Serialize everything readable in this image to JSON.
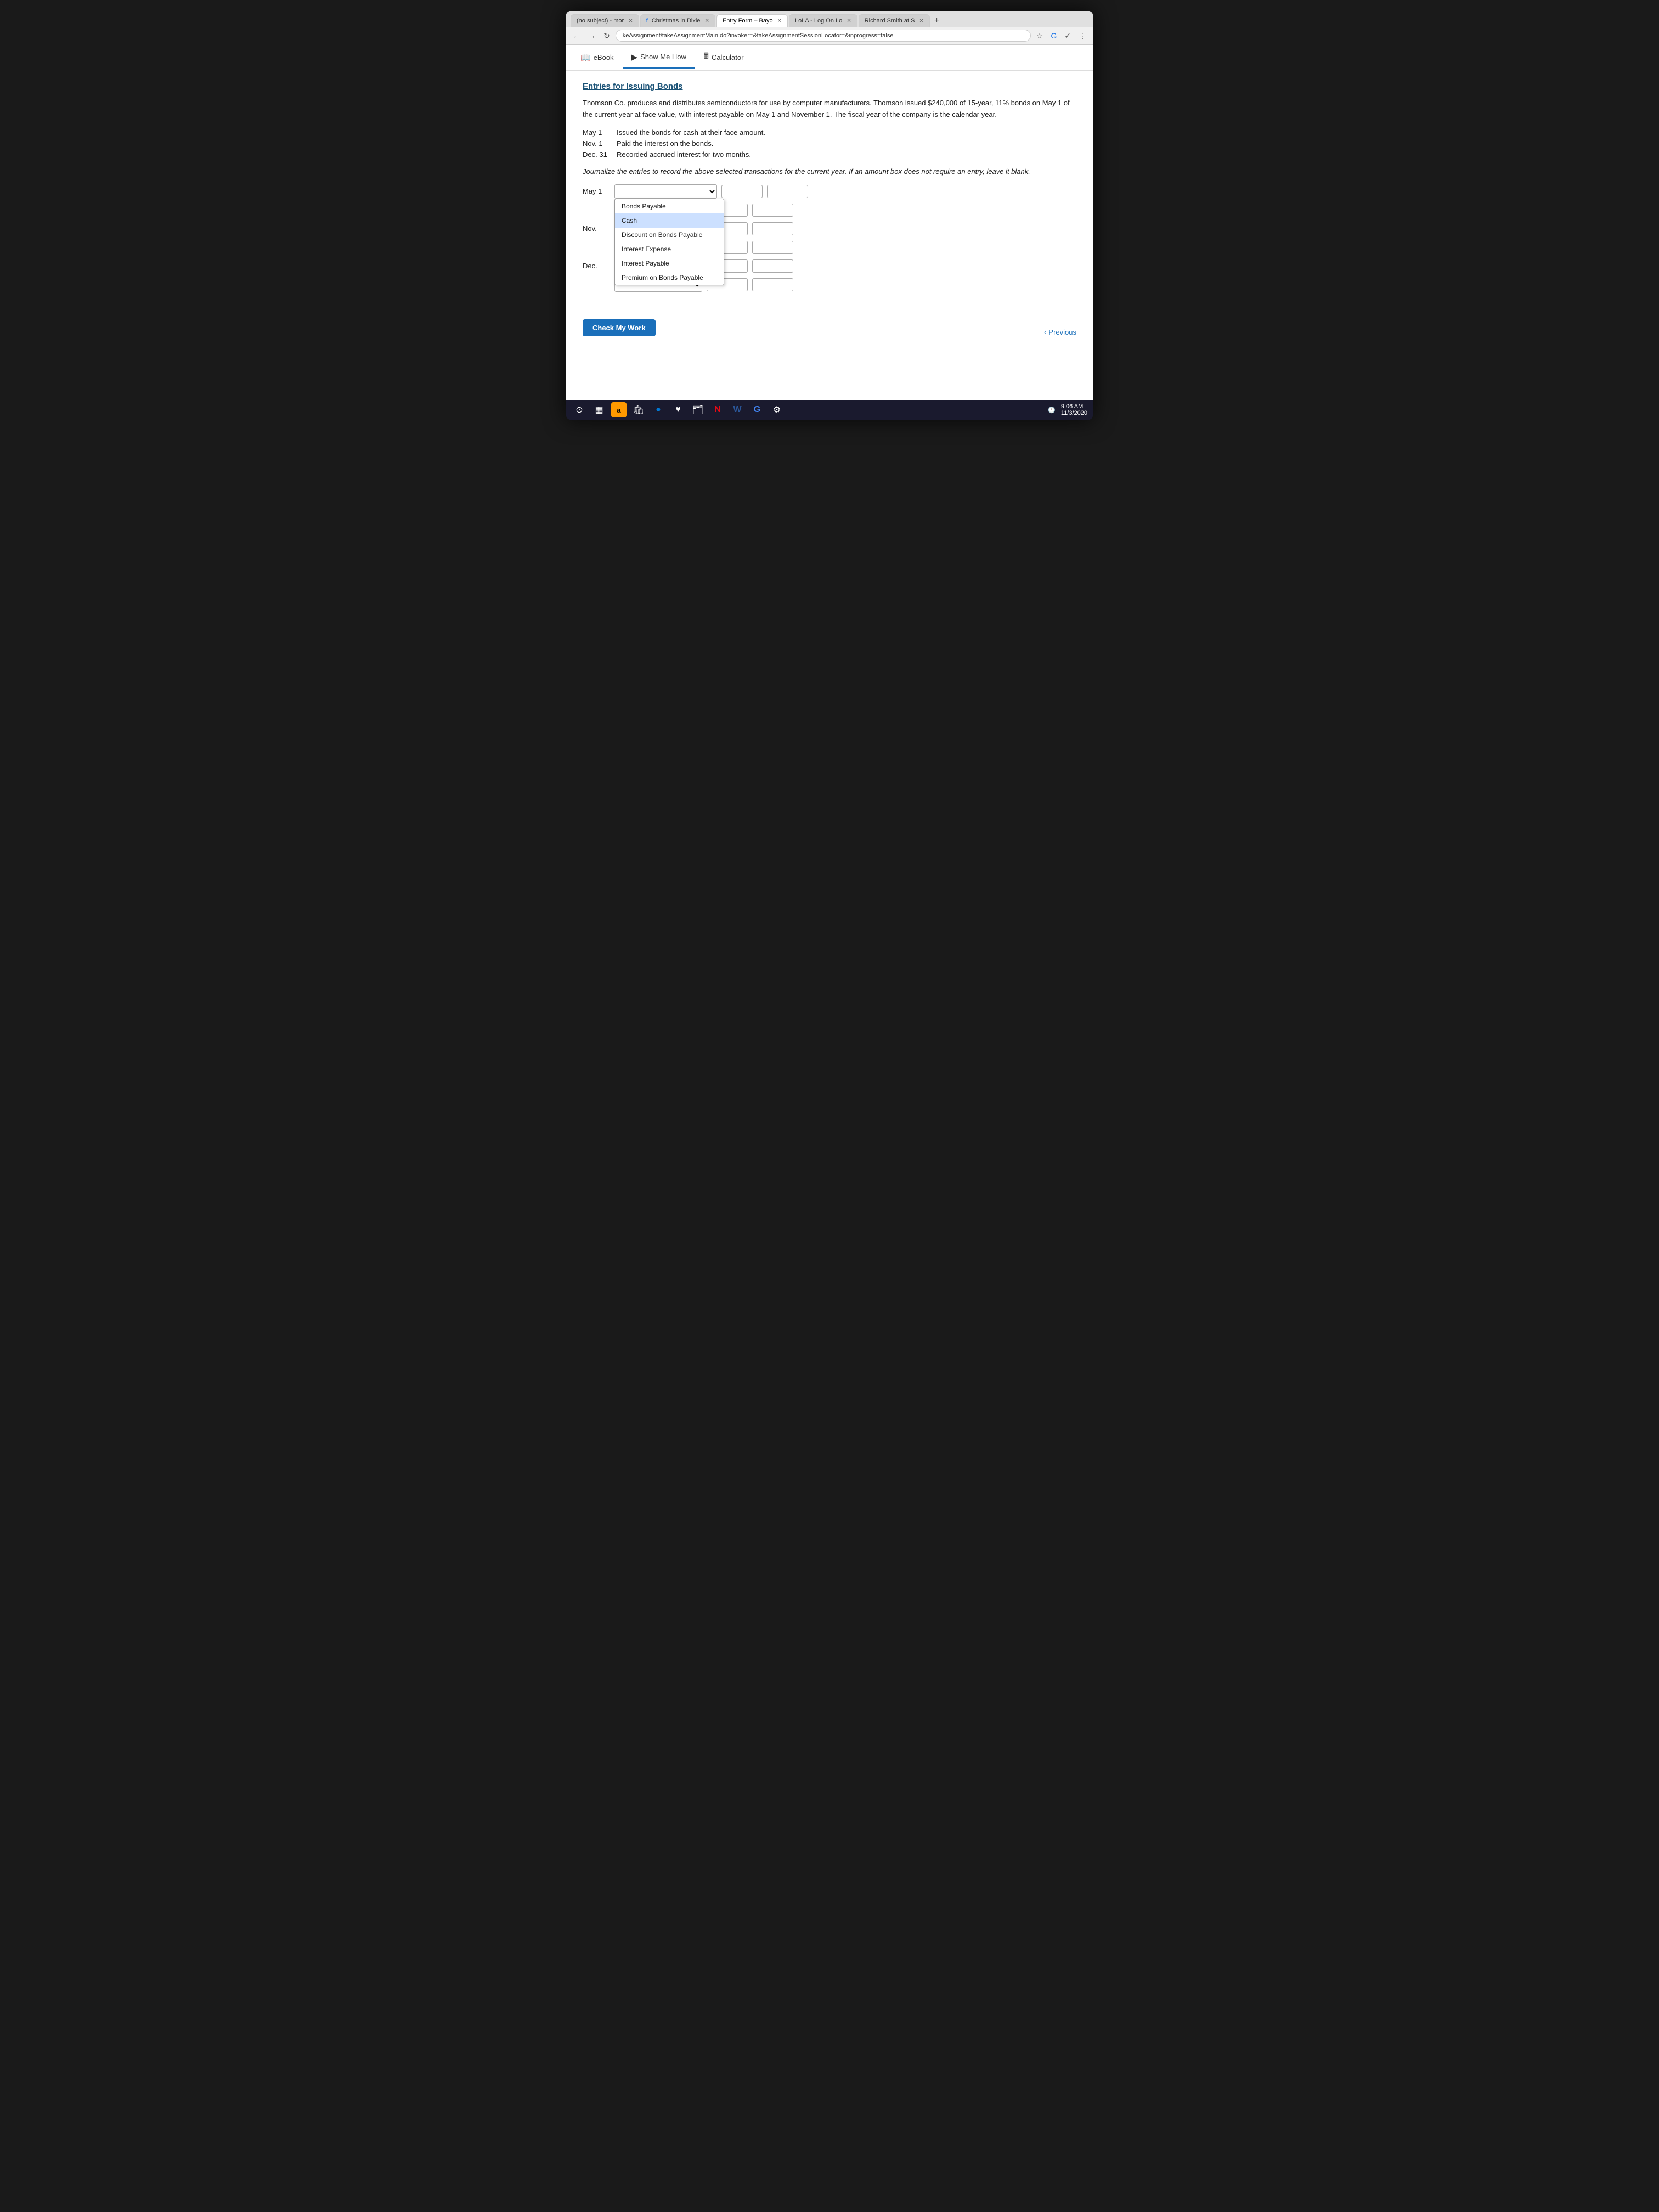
{
  "browser": {
    "tabs": [
      {
        "label": "(no subject) - mor",
        "active": false
      },
      {
        "label": "Christmas in Dixie",
        "active": false
      },
      {
        "label": "Entry Form – Bayo",
        "active": true
      },
      {
        "label": "LoLA - Log On Lo",
        "active": false
      },
      {
        "label": "Richard Smith at S",
        "active": false
      }
    ],
    "address": "keAssignment/takeAssignmentMain.do?invoker=&takeAssignmentSessionLocator=&inprogress=false"
  },
  "toolbar": {
    "ebook_label": "eBook",
    "show_me_how_label": "Show Me How",
    "calculator_label": "Calculator"
  },
  "main": {
    "section_title": "Entries for Issuing Bonds",
    "problem_text_1": "Thomson Co. produces and distributes semiconductors for use by computer manufacturers. Thomson issued $240,000 of 15-year, 11% bonds on May 1 of the current year at face value, with interest payable on May 1 and November 1. The fiscal year of the company is the calendar year.",
    "transactions": [
      {
        "date": "May 1",
        "description": "Issued the bonds for cash at their face amount."
      },
      {
        "date": "Nov. 1",
        "description": "Paid the interest on the bonds."
      },
      {
        "date": "Dec. 31",
        "description": "Recorded accrued interest for two months."
      }
    ],
    "instruction": "Journalize the entries to record the above selected transactions for the current year. If an amount box does not require an entry, leave it blank.",
    "journal_rows": [
      {
        "date": "May 1",
        "account": "",
        "debit": "",
        "credit": ""
      },
      {
        "date": "",
        "account": "",
        "debit": "",
        "credit": ""
      },
      {
        "date": "Nov.",
        "account": "",
        "debit": "",
        "credit": ""
      },
      {
        "date": "",
        "account": "",
        "debit": "",
        "credit": ""
      },
      {
        "date": "Dec.",
        "account": "",
        "debit": "",
        "credit": ""
      },
      {
        "date": "",
        "account": "",
        "debit": "",
        "credit": ""
      }
    ],
    "dropdown_options": [
      "Bonds Payable",
      "Cash",
      "Discount on Bonds Payable",
      "Interest Expense",
      "Interest Payable",
      "Premium on Bonds Payable"
    ],
    "check_btn_label": "Check My Work",
    "previous_label": "Previous"
  },
  "taskbar": {
    "time": "9:06 AM",
    "date": "11/3/2020",
    "icons": [
      "⊙",
      "▦",
      "a",
      "🛍",
      "●",
      "♥",
      "🗂",
      "N",
      "W",
      "G",
      "⚙"
    ]
  }
}
